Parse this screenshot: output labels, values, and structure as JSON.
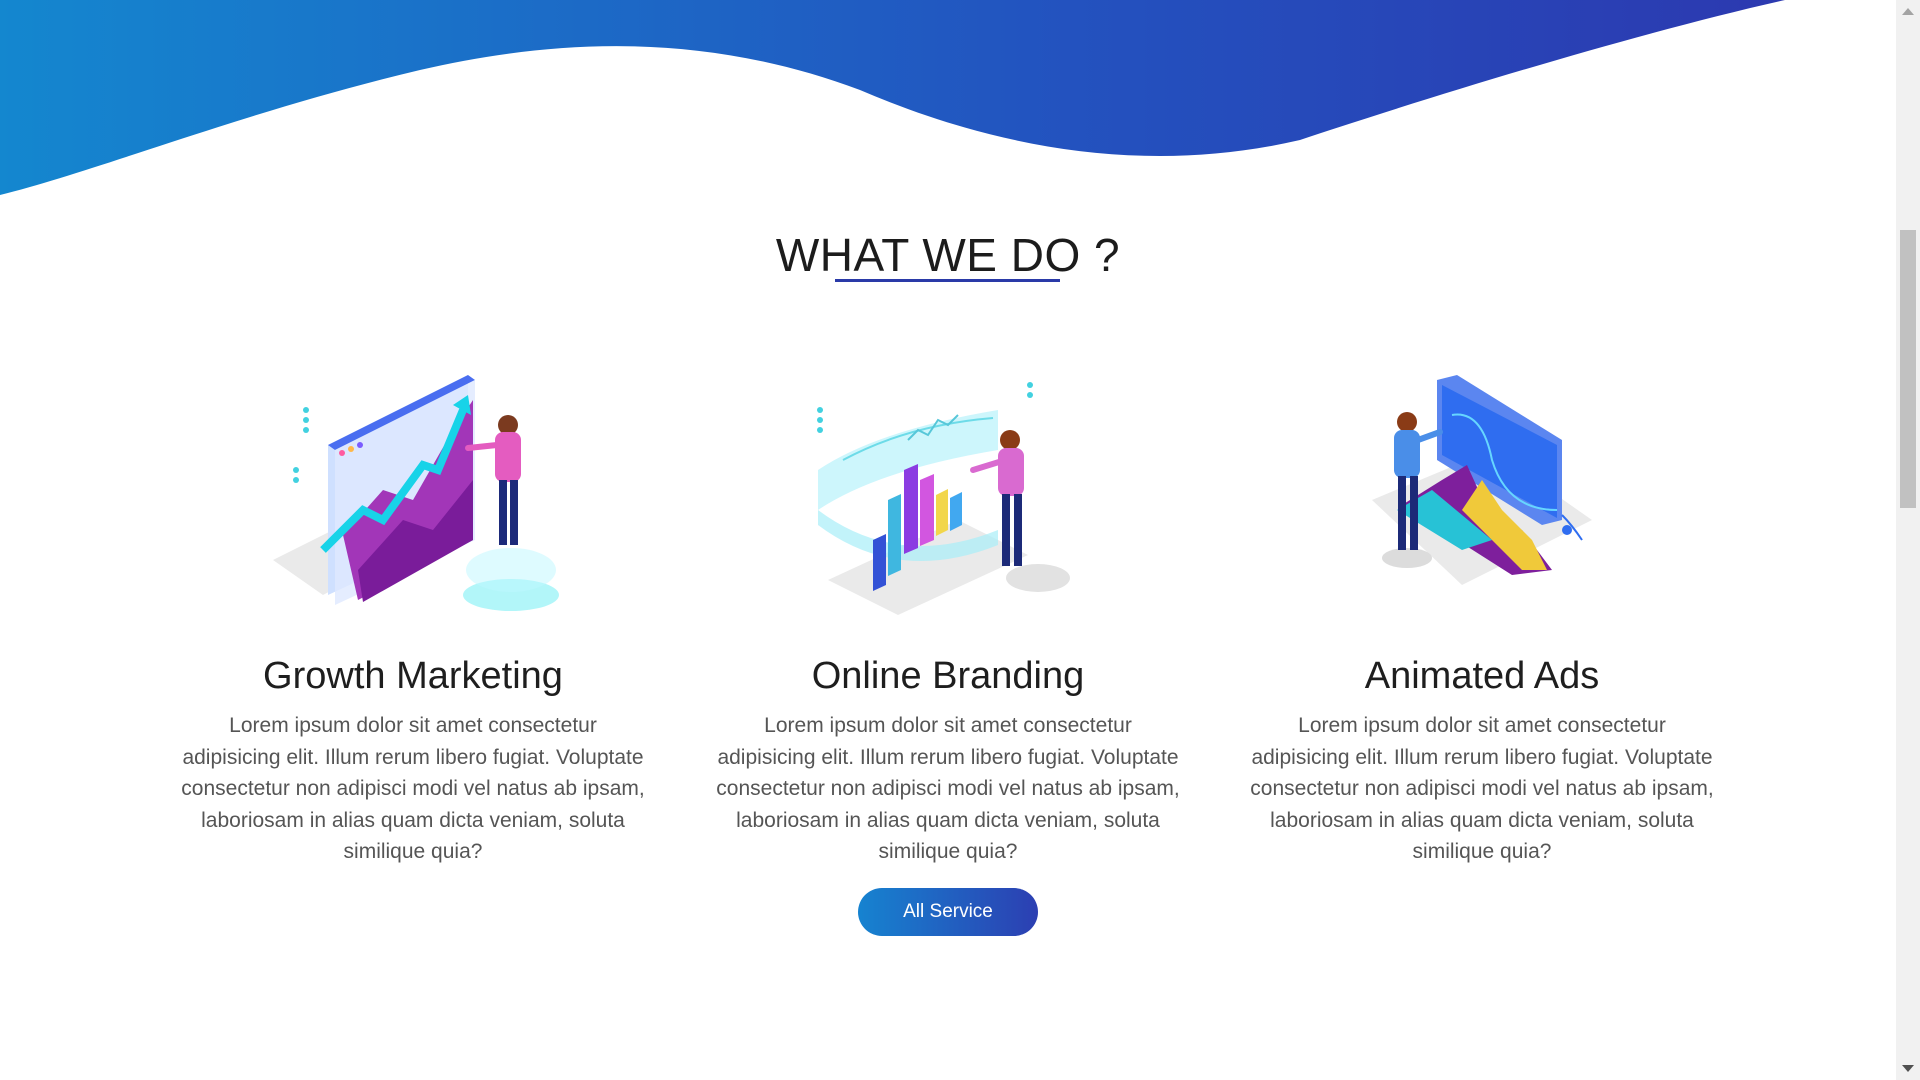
{
  "section": {
    "title": "WHAT WE DO ?"
  },
  "services": [
    {
      "title": "Growth Marketing",
      "description": "Lorem ipsum dolor sit amet consectetur adipisicing elit. Illum rerum libero fugiat. Voluptate consectetur non adipisci modi vel natus ab ipsam, laboriosam in alias quam dicta veniam, soluta similique quia?",
      "illustration_icon": "growth-chart-illustration"
    },
    {
      "title": "Online Branding",
      "description": "Lorem ipsum dolor sit amet consectetur adipisicing elit. Illum rerum libero fugiat. Voluptate consectetur non adipisci modi vel natus ab ipsam, laboriosam in alias quam dicta veniam, soluta similique quia?",
      "illustration_icon": "bar-chart-hologram-illustration"
    },
    {
      "title": "Animated Ads",
      "description": "Lorem ipsum dolor sit amet consectetur adipisicing elit. Illum rerum libero fugiat. Voluptate consectetur non adipisci modi vel natus ab ipsam, laboriosam in alias quam dicta veniam, soluta similique quia?",
      "illustration_icon": "monitor-analytics-illustration"
    }
  ],
  "cta": {
    "label": "All Service"
  },
  "colors": {
    "gradient_start": "#1683d0",
    "gradient_end": "#2c3fb2",
    "underline": "#2a3aa8"
  }
}
